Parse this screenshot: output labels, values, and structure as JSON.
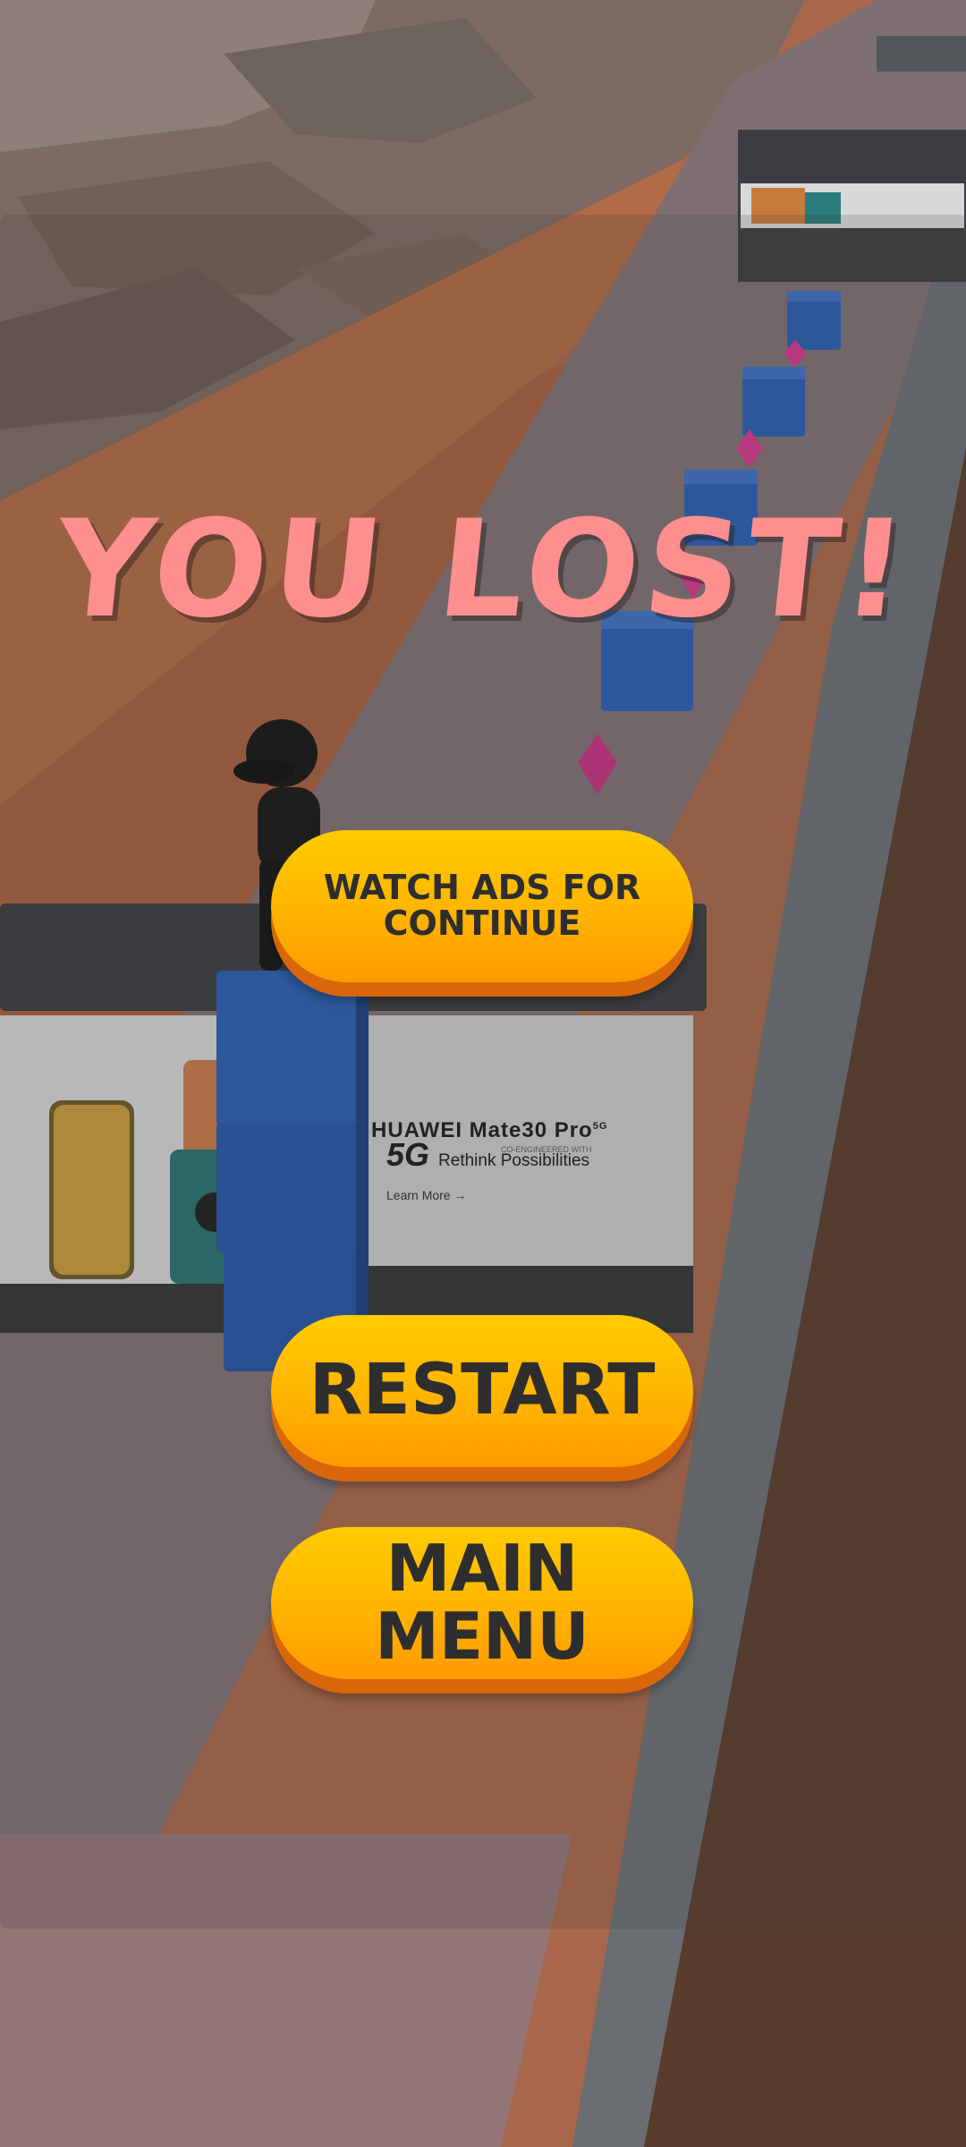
{
  "title": "YOU LOST!",
  "buttons": {
    "watch_ads": "WATCH ADS FOR CONTINUE",
    "restart": "RESTART",
    "main_menu": "MAIN MENU"
  },
  "billboard": {
    "brand": "HUAWEI Mate30 Pro",
    "brand_sup": "5G",
    "cobrand": "CO-ENGINEERED WITH",
    "headline": "5G",
    "tagline": "Rethink Possibilities",
    "cta": "Learn More →"
  },
  "colors": {
    "title": "#ff8f8f",
    "button_top": "#ffcb00",
    "button_bottom": "#ff9a00",
    "button_text": "#2e2e2e",
    "block_blue": "#2a5db0",
    "gem_pink": "#d0398a"
  }
}
